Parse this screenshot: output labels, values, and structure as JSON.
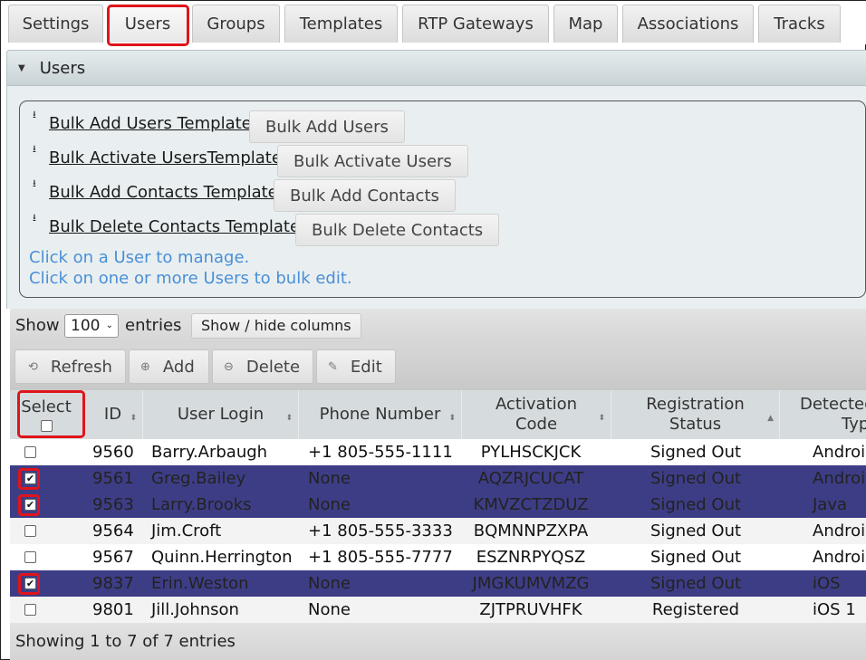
{
  "tabs": [
    {
      "label": "Settings"
    },
    {
      "label": "Users"
    },
    {
      "label": "Groups"
    },
    {
      "label": "Templates"
    },
    {
      "label": "RTP Gateways"
    },
    {
      "label": "Map"
    },
    {
      "label": "Associations"
    },
    {
      "label": "Tracks"
    }
  ],
  "active_tab": "Users",
  "section": {
    "title": "Users"
  },
  "bulk": {
    "rows": [
      {
        "template_link": "Bulk Add Users Template",
        "button": "Bulk Add Users"
      },
      {
        "template_link": "Bulk Activate UsersTemplate",
        "button": "Bulk Activate Users"
      },
      {
        "template_link": "Bulk Add Contacts Template",
        "button": "Bulk Add Contacts"
      },
      {
        "template_link": "Bulk Delete Contacts Template",
        "button": "Bulk Delete Contacts"
      }
    ],
    "hint1": "Click on a User to manage.",
    "hint2": "Click on one or more Users to bulk edit."
  },
  "length_menu": {
    "show_label": "Show",
    "value": "100",
    "entries_label": "entries"
  },
  "show_hide_label": "Show / hide columns",
  "toolbar": {
    "refresh": "Refresh",
    "add": "Add",
    "delete": "Delete",
    "edit": "Edit"
  },
  "columns": {
    "select": "Select",
    "id": "ID",
    "login": "User Login",
    "phone": "Phone Number",
    "activation_line1": "Activation",
    "activation_line2": "Code",
    "registration_line1": "Registration",
    "registration_line2": "Status",
    "detected_line1": "Detected",
    "detected_line2": "Typ"
  },
  "rows": [
    {
      "checked": false,
      "id": "9560",
      "login": "Barry.Arbaugh",
      "phone": "+1 805-555-1111",
      "code": "PYLHSCKJCK",
      "status": "Signed Out",
      "type": "Androi"
    },
    {
      "checked": true,
      "id": "9561",
      "login": "Greg.Bailey",
      "phone": "None",
      "code": "AQZRJCUCAT",
      "status": "Signed Out",
      "type": "Androi"
    },
    {
      "checked": true,
      "id": "9563",
      "login": "Larry.Brooks",
      "phone": "None",
      "code": "KMVZCTZDUZ",
      "status": "Signed Out",
      "type": "Java"
    },
    {
      "checked": false,
      "id": "9564",
      "login": "Jim.Croft",
      "phone": "+1 805-555-3333",
      "code": "BQMNNPZXPA",
      "status": "Signed Out",
      "type": "Androi"
    },
    {
      "checked": false,
      "id": "9567",
      "login": "Quinn.Herrington",
      "phone": "+1 805-555-7777",
      "code": "ESZNRPYQSZ",
      "status": "Signed Out",
      "type": "Androi"
    },
    {
      "checked": true,
      "id": "9837",
      "login": "Erin.Weston",
      "phone": "None",
      "code": "JMGKUMVMZG",
      "status": "Signed Out",
      "type": "iOS"
    },
    {
      "checked": false,
      "id": "9801",
      "login": "Jill.Johnson",
      "phone": "None",
      "code": "ZJTPRUVHFK",
      "status": "Registered",
      "type": "iOS 1"
    }
  ],
  "footer": {
    "info": "Showing 1 to 7 of 7 entries"
  },
  "colors": {
    "selected_row": "#3d3d86",
    "highlight": "#e0141b",
    "hint": "#4a8fd6"
  }
}
